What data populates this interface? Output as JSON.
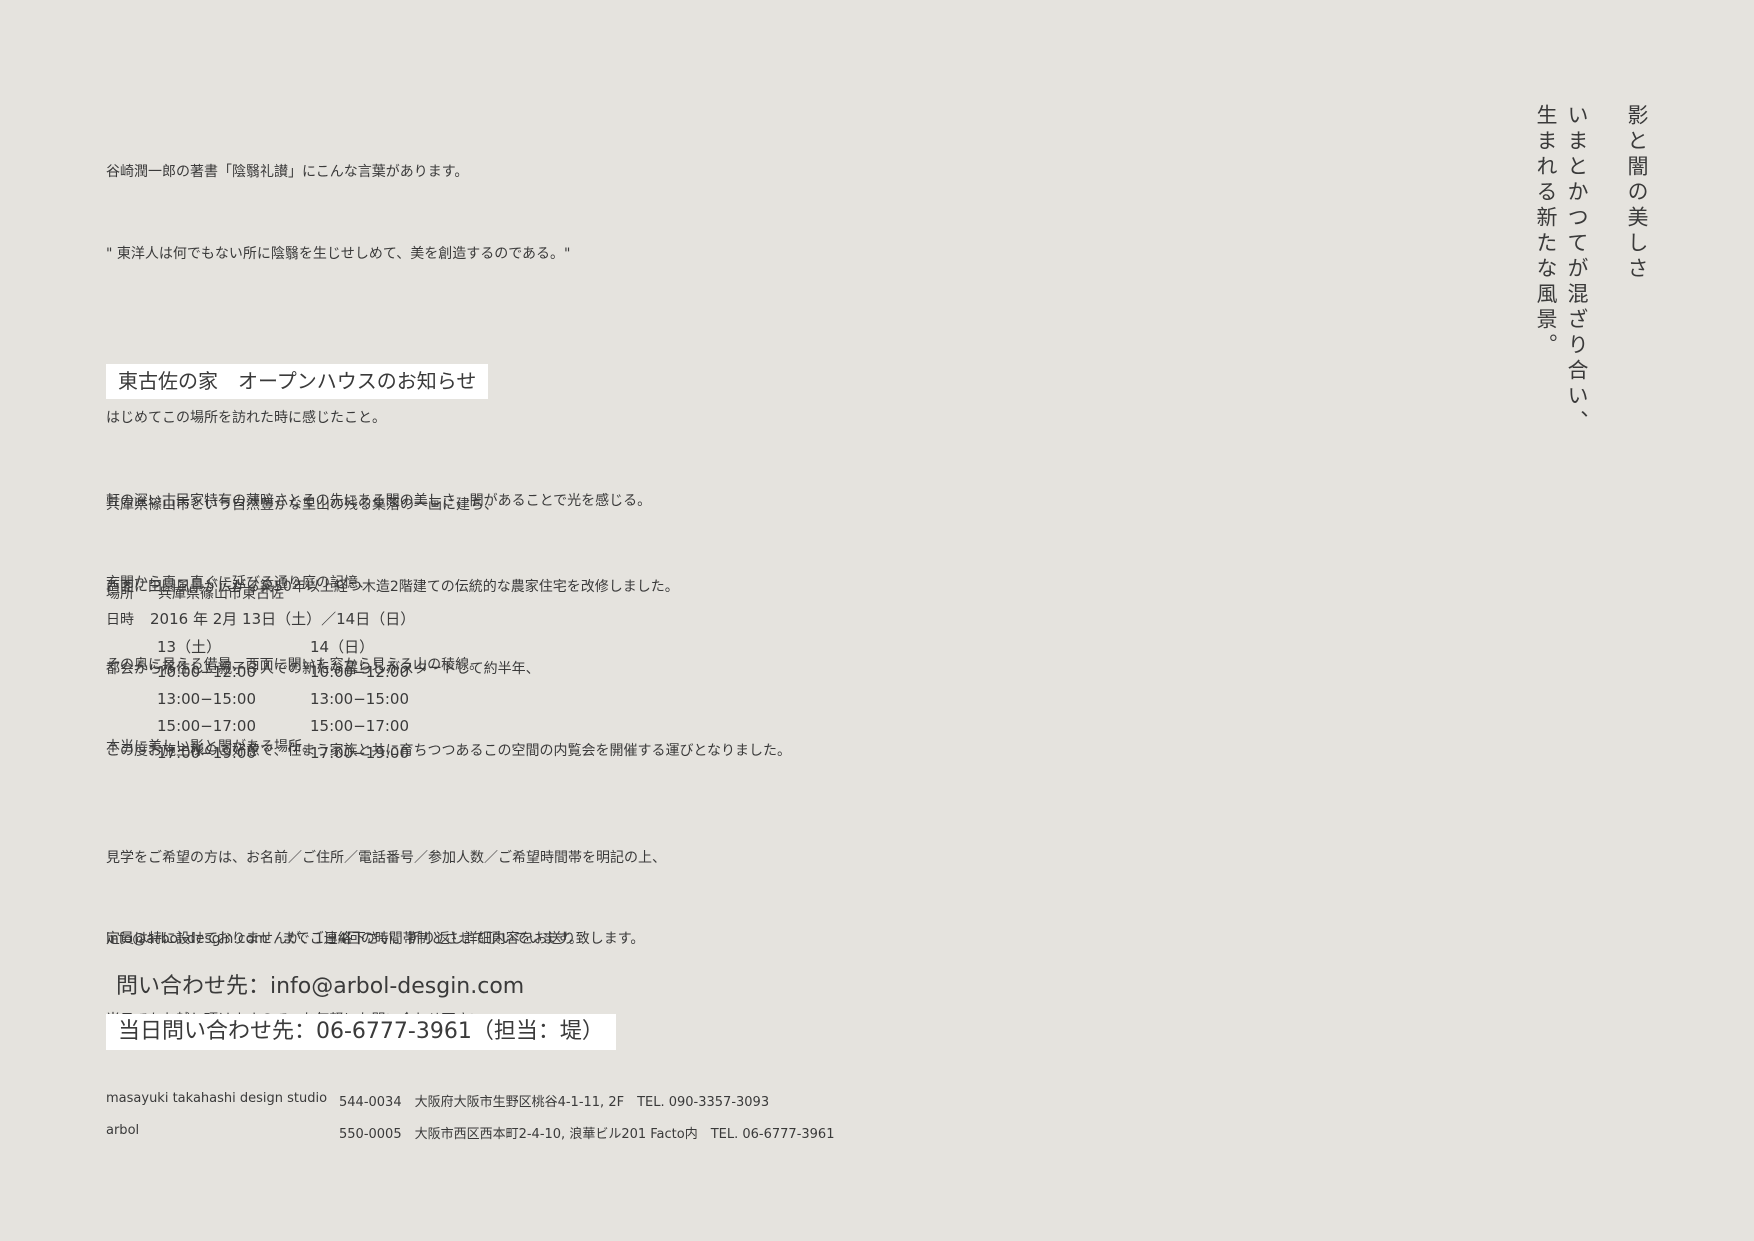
{
  "intro": {
    "lines": [
      "谷崎潤一郎の著書「陰翳礼讃」にこんな言葉があります。",
      "\" 東洋人は何でもない所に陰翳を生じせしめて、美を創造するのである。\"",
      "",
      "はじめてこの場所を訪れた時に感じたこと。",
      "軒の深い古民家特有の薄暗さとその先にある闇の美しさ、闇があることで光を感じる。",
      "玄関から真っ直ぐに延びる通り庭の記憶、",
      "その奥に見える借景、西面に開いた窓から見える山の稜線。",
      "本当に美しい影と闇がある場所。"
    ]
  },
  "heading": "東古佐の家　オープンハウスのお知らせ",
  "description": {
    "lines": [
      "兵庫県篠山市という自然豊かな里山の残る集落の一画に建ち、",
      "西面に田園風景が広がる築50年以上経つ木造2階建ての伝統的な農家住宅を改修しました。",
      "都会から移住した親子３人での新たな暮らしがスタートして約半年、",
      "この度お施主様のご好意で、住まう家族と共に育ちつつあるこの空間の内覧会を開催する運びとなりました。"
    ]
  },
  "event": {
    "place_label": "場所",
    "place_value": "兵庫県篠山市東古佐",
    "date_label": "日時",
    "date_value": "2016 年 2月 13日（土）／14日（日）",
    "day1": "13（土）",
    "day2": "14（日）",
    "slots": [
      "10:00−12:00",
      "13:00−15:00",
      "15:00−17:00",
      "17:00−19:00"
    ]
  },
  "notes": {
    "apply": [
      "見学をご希望の方は、お名前／ご住所／電話番号／参加人数／ご希望時間帯を明記の上、",
      "info@arbol-desgin.com　までご連絡下さい。折り返し詳細内容をお送り致します。"
    ],
    "capacity": [
      "定員は特に設けておりませんが、1日4回の時間帯制とさせて頂いています。",
      "当日でもお越し頂けますので、お気軽にお問い合わせ下さい。"
    ]
  },
  "contact": {
    "email_line": "問い合わせ先：info@arbol-desgin.com",
    "phone_line": "当日問い合わせ先：06-6777-3961（担当：堤）"
  },
  "footer": {
    "studio1_name": "masayuki takahashi design studio",
    "studio1_address": "544-0034　大阪府大阪市生野区桃谷4-1-11, 2F　TEL. 090-3357-3093",
    "studio2_name": "arbol",
    "studio2_address": "550-0005　大阪市西区西本町2-4-10, 浪華ビル201 Facto内　TEL. 06-6777-3961"
  },
  "vertical": {
    "title": "影と闇の美しさ",
    "line1": "いまとかつてが混ざり合い、",
    "line2": "生まれる新たな風景。"
  }
}
